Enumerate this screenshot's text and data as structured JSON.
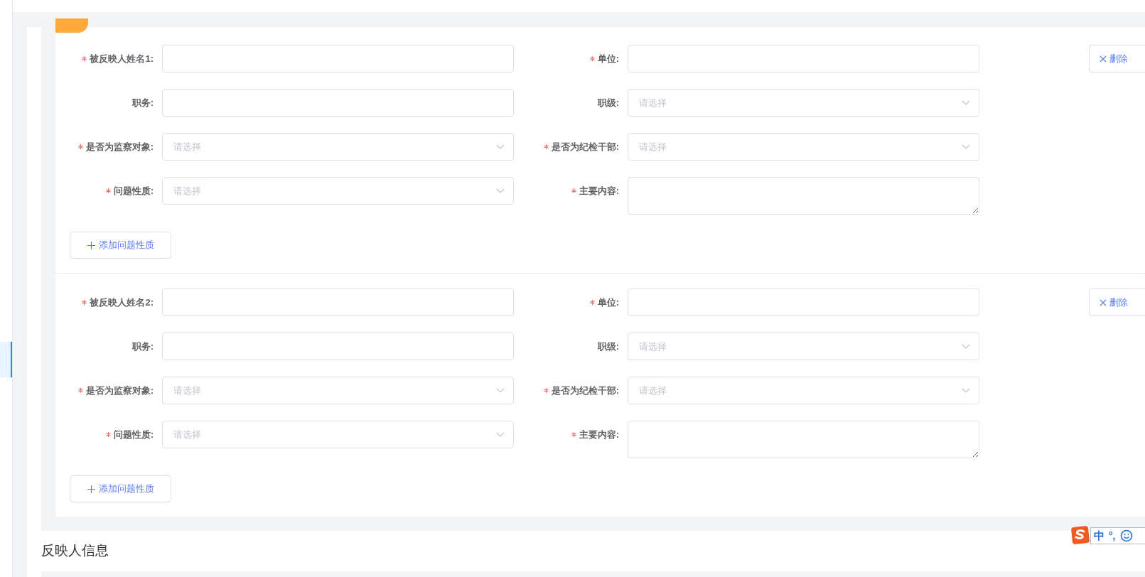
{
  "persons": [
    {
      "fields": [
        {
          "label": "被反映人姓名1:",
          "required": true,
          "kind": "input"
        },
        {
          "label": "单位:",
          "required": true,
          "kind": "input"
        },
        {
          "label": "职务:",
          "required": false,
          "kind": "input"
        },
        {
          "label": "职级:",
          "required": false,
          "kind": "select",
          "placeholder": "请选择"
        },
        {
          "label": "是否为监察对象:",
          "required": true,
          "kind": "select",
          "placeholder": "请选择"
        },
        {
          "label": "是否为纪检干部:",
          "required": true,
          "kind": "select",
          "placeholder": "请选择"
        },
        {
          "label": "问题性质:",
          "required": true,
          "kind": "select",
          "placeholder": "请选择"
        },
        {
          "label": "主要内容:",
          "required": true,
          "kind": "textarea"
        }
      ],
      "delete_button": "删除",
      "add_button": "添加问题性质"
    },
    {
      "fields": [
        {
          "label": "被反映人姓名2:",
          "required": true,
          "kind": "input"
        },
        {
          "label": "单位:",
          "required": true,
          "kind": "input"
        },
        {
          "label": "职务:",
          "required": false,
          "kind": "input"
        },
        {
          "label": "职级:",
          "required": false,
          "kind": "select",
          "placeholder": "请选择"
        },
        {
          "label": "是否为监察对象:",
          "required": true,
          "kind": "select",
          "placeholder": "请选择"
        },
        {
          "label": "是否为纪检干部:",
          "required": true,
          "kind": "select",
          "placeholder": "请选择"
        },
        {
          "label": "问题性质:",
          "required": true,
          "kind": "select",
          "placeholder": "请选择"
        },
        {
          "label": "主要内容:",
          "required": true,
          "kind": "textarea"
        }
      ],
      "delete_button": "删除",
      "add_button": "添加问题性质"
    }
  ],
  "section_title": "反映人信息",
  "ime_toolbar": {
    "mode": "中",
    "punctuation": "°,"
  }
}
